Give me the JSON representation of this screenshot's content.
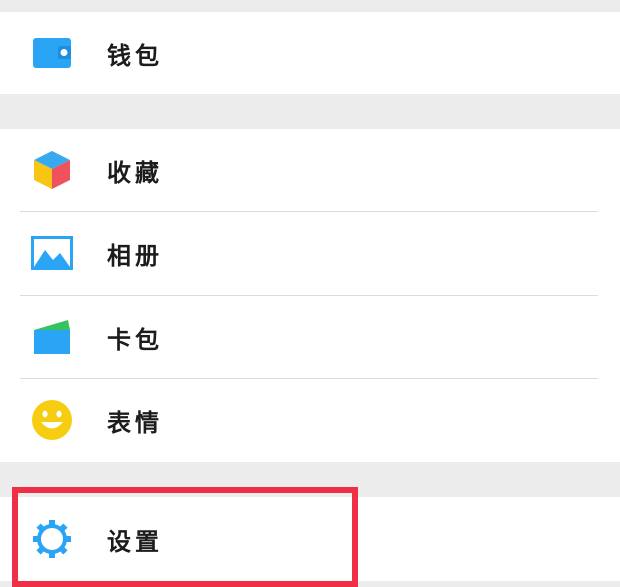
{
  "menu": {
    "wallet": {
      "label": "钱包",
      "icon": "wallet-icon"
    },
    "favorites": {
      "label": "收藏",
      "icon": "cube-icon"
    },
    "album": {
      "label": "相册",
      "icon": "picture-icon"
    },
    "card_wallet": {
      "label": "卡包",
      "icon": "card-holder-icon"
    },
    "stickers": {
      "label": "表情",
      "icon": "smiley-icon"
    },
    "settings": {
      "label": "设置",
      "icon": "gear-icon"
    }
  },
  "colors": {
    "accent_blue": "#2aa4f4",
    "highlight_red": "#ee2f45",
    "background_gray": "#ececec",
    "smiley_yellow": "#f7cd12"
  }
}
